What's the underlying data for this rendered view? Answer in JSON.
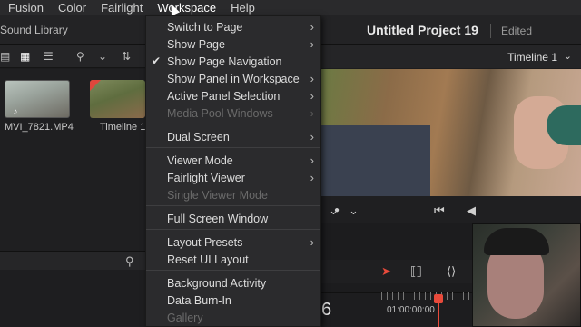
{
  "menubar": {
    "items": [
      "Fusion",
      "Color",
      "Fairlight",
      "Workspace",
      "Help"
    ],
    "active": "Workspace"
  },
  "topbar": {
    "sound_library": "Sound Library",
    "project_title": "Untitled Project 19",
    "project_state": "Edited"
  },
  "viewer": {
    "timeline_name": "Timeline 1"
  },
  "media_pool": {
    "clips": [
      {
        "name": "MVI_7821.MP4"
      },
      {
        "name": "Timeline 1"
      }
    ]
  },
  "timeline": {
    "big_digit": "6",
    "timecode": "01:00:00:00"
  },
  "dropdown": {
    "items": [
      {
        "label": "Switch to Page",
        "submenu": true,
        "disabled": false,
        "checked": false
      },
      {
        "label": "Show Page",
        "submenu": true,
        "disabled": false,
        "checked": false
      },
      {
        "label": "Show Page Navigation",
        "submenu": false,
        "disabled": false,
        "checked": true
      },
      {
        "label": "Show Panel in Workspace",
        "submenu": true,
        "disabled": false,
        "checked": false
      },
      {
        "label": "Active Panel Selection",
        "submenu": true,
        "disabled": false,
        "checked": false
      },
      {
        "label": "Media Pool Windows",
        "submenu": true,
        "disabled": true,
        "checked": false
      },
      {
        "label": "Dual Screen",
        "submenu": true,
        "disabled": false,
        "checked": false
      },
      {
        "label": "Viewer Mode",
        "submenu": true,
        "disabled": false,
        "checked": false
      },
      {
        "label": "Fairlight Viewer",
        "submenu": true,
        "disabled": false,
        "checked": false
      },
      {
        "label": "Single Viewer Mode",
        "submenu": false,
        "disabled": true,
        "checked": false
      },
      {
        "label": "Full Screen Window",
        "submenu": false,
        "disabled": false,
        "checked": false
      },
      {
        "label": "Layout Presets",
        "submenu": true,
        "disabled": false,
        "checked": false
      },
      {
        "label": "Reset UI Layout",
        "submenu": false,
        "disabled": false,
        "checked": false
      },
      {
        "label": "Background Activity",
        "submenu": false,
        "disabled": false,
        "checked": false
      },
      {
        "label": "Data Burn-In",
        "submenu": false,
        "disabled": false,
        "checked": false
      },
      {
        "label": "Gallery",
        "submenu": false,
        "disabled": true,
        "checked": false
      }
    ],
    "check_glyph": "✔",
    "arrow_glyph": "›"
  },
  "icons": {
    "list_view": "list-view-icon",
    "grid_view": "grid-view-icon",
    "detail_view": "detail-view-icon",
    "search": "search-icon",
    "sort": "sort-icon",
    "chevron": "chevron-down-icon"
  },
  "colors": {
    "accent_red": "#e84a3b",
    "menu_bg": "#2b2b2d",
    "disabled_text": "#6a6a6a"
  }
}
